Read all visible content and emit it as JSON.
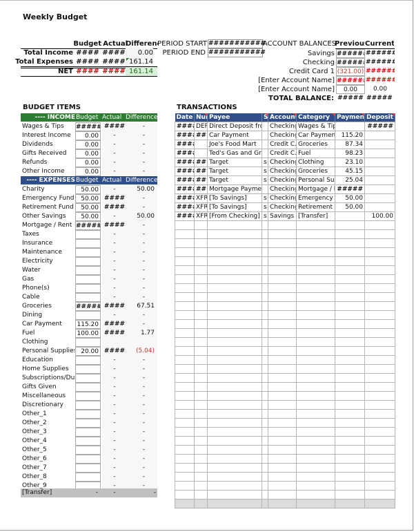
{
  "title": "Weekly Budget",
  "summary": {
    "headers": [
      "Budget",
      "Actual",
      "Difference"
    ],
    "rows": [
      {
        "label": "Total Income",
        "budget": "####",
        "actual": "####",
        "difference": "0.00"
      },
      {
        "label": "Total Expenses",
        "budget": "####",
        "actual": "####",
        "difference": "161.14"
      },
      {
        "label": "NET",
        "budget": "####",
        "actual": "####",
        "difference": "161.14"
      }
    ]
  },
  "period": {
    "start_label": "PERIOD START",
    "start_value": "###########",
    "end_label": "PERIOD END",
    "end_value": "###########"
  },
  "account_balances": {
    "title": "ACCOUNT BALANCES",
    "headers": [
      "Previous",
      "Current"
    ],
    "rows": [
      {
        "name": "Savings",
        "previous": "######",
        "current": "######"
      },
      {
        "name": "Checking",
        "previous": "######",
        "current": "######"
      },
      {
        "name": "Credit Card 1",
        "previous": "(321.00)",
        "current": "######"
      },
      {
        "name": "[Enter Account Name]",
        "previous": "######",
        "current": "######"
      },
      {
        "name": "[Enter Account Name]",
        "previous": "0.00",
        "current": "0.00"
      }
    ],
    "total_label": "TOTAL BALANCE:",
    "total_previous": "#####",
    "total_current": "#####"
  },
  "budget_items": {
    "title": "BUDGET ITEMS",
    "income_header": {
      "label": "---- INCOME",
      "budget": "Budget",
      "actual": "Actual",
      "difference": "Difference"
    },
    "income": [
      {
        "name": "Wages & Tips",
        "budget": "#####",
        "actual": "####",
        "difference": "-"
      },
      {
        "name": "Interest Income",
        "budget": "0.00",
        "actual": "-",
        "difference": "-"
      },
      {
        "name": "Dividends",
        "budget": "0.00",
        "actual": "-",
        "difference": "-"
      },
      {
        "name": "Gifts Received",
        "budget": "0.00",
        "actual": "-",
        "difference": "-"
      },
      {
        "name": "Refunds",
        "budget": "0.00",
        "actual": "-",
        "difference": "-"
      },
      {
        "name": "Other Income",
        "budget": "0.00",
        "actual": "-",
        "difference": "-"
      }
    ],
    "expense_header": {
      "label": "---- EXPENSES",
      "budget": "Budget",
      "actual": "Actual",
      "difference": "Difference"
    },
    "expenses": [
      {
        "name": "Charity",
        "budget": "50.00",
        "actual": "-",
        "difference": "50.00"
      },
      {
        "name": "Emergency Fund",
        "budget": "50.00",
        "actual": "####",
        "difference": "-"
      },
      {
        "name": "Retirement Fund",
        "budget": "50.00",
        "actual": "####",
        "difference": "-"
      },
      {
        "name": "Other Savings",
        "budget": "50.00",
        "actual": "-",
        "difference": "50.00"
      },
      {
        "name": "Mortgage / Rent",
        "budget": "#####",
        "actual": "####",
        "difference": "-"
      },
      {
        "name": "Taxes",
        "budget": "",
        "actual": "-",
        "difference": "-"
      },
      {
        "name": "Insurance",
        "budget": "",
        "actual": "-",
        "difference": "-"
      },
      {
        "name": "Maintenance",
        "budget": "",
        "actual": "-",
        "difference": "-"
      },
      {
        "name": "Electricity",
        "budget": "",
        "actual": "-",
        "difference": "-"
      },
      {
        "name": "Water",
        "budget": "",
        "actual": "-",
        "difference": "-"
      },
      {
        "name": "Gas",
        "budget": "",
        "actual": "-",
        "difference": "-"
      },
      {
        "name": "Phone(s)",
        "budget": "",
        "actual": "-",
        "difference": "-"
      },
      {
        "name": "Cable",
        "budget": "",
        "actual": "-",
        "difference": "-"
      },
      {
        "name": "Groceries",
        "budget": "#####",
        "actual": "####",
        "difference": "67.51"
      },
      {
        "name": "Dining",
        "budget": "",
        "actual": "-",
        "difference": "-"
      },
      {
        "name": "Car Payment",
        "budget": "115.20",
        "actual": "####",
        "difference": "-"
      },
      {
        "name": "Fuel",
        "budget": "100.00",
        "actual": "####",
        "difference": "1.77"
      },
      {
        "name": "Clothing",
        "budget": "",
        "actual": "",
        "difference": ""
      },
      {
        "name": "Personal Supplies",
        "budget": "20.00",
        "actual": "####",
        "difference": "(5.04)"
      },
      {
        "name": "Education",
        "budget": "",
        "actual": "-",
        "difference": "-"
      },
      {
        "name": "Home Supplies",
        "budget": "",
        "actual": "-",
        "difference": "-"
      },
      {
        "name": "Subscriptions/Dues",
        "budget": "",
        "actual": "-",
        "difference": "-"
      },
      {
        "name": "Gifts Given",
        "budget": "",
        "actual": "-",
        "difference": "-"
      },
      {
        "name": "Miscellaneous",
        "budget": "",
        "actual": "-",
        "difference": "-"
      },
      {
        "name": "Discretionary",
        "budget": "",
        "actual": "-",
        "difference": "-"
      },
      {
        "name": "Other_1",
        "budget": "",
        "actual": "-",
        "difference": "-"
      },
      {
        "name": "Other_2",
        "budget": "",
        "actual": "-",
        "difference": "-"
      },
      {
        "name": "Other_3",
        "budget": "",
        "actual": "-",
        "difference": "-"
      },
      {
        "name": "Other_4",
        "budget": "",
        "actual": "-",
        "difference": "-"
      },
      {
        "name": "Other_5",
        "budget": "",
        "actual": "-",
        "difference": "-"
      },
      {
        "name": "Other_6",
        "budget": "",
        "actual": "-",
        "difference": "-"
      },
      {
        "name": "Other_7",
        "budget": "",
        "actual": "-",
        "difference": "-"
      },
      {
        "name": "Other_8",
        "budget": "",
        "actual": "-",
        "difference": "-"
      },
      {
        "name": "Other_9",
        "budget": "",
        "actual": "-",
        "difference": "-"
      }
    ],
    "transfer_row": {
      "name": "[Transfer]",
      "budget": "-",
      "actual": "-",
      "difference": "-"
    }
  },
  "transactions": {
    "title": "TRANSACTIONS",
    "headers": [
      "Date",
      "Num",
      "Payee",
      "S",
      "Account",
      "Category",
      "Payment",
      "Deposit"
    ],
    "rows": [
      [
        "####",
        "DEP",
        "Direct Deposit from",
        "",
        "Checking",
        "Wages & Tips",
        "",
        "#####"
      ],
      [
        "####",
        "##",
        "Car Payment",
        "",
        "Checking",
        "Car Payment",
        "115.20",
        ""
      ],
      [
        "####",
        "",
        "Joe's Food Mart",
        "",
        "Credit C.",
        "Groceries",
        "87.34",
        ""
      ],
      [
        "####",
        "",
        "Ted's Gas and Grub",
        "",
        "Credit C.",
        "Fuel",
        "98.23",
        ""
      ],
      [
        "####",
        "##",
        "Target",
        "s",
        "Checking",
        "Clothing",
        "23.10",
        ""
      ],
      [
        "####",
        "##",
        "Target",
        "s",
        "Checking",
        "Groceries",
        "45.15",
        ""
      ],
      [
        "####",
        "##",
        "Target",
        "s",
        "Checking",
        "Personal Supplies",
        "25.04",
        ""
      ],
      [
        "####",
        "##",
        "Mortgage Payment",
        "",
        "Checking",
        "Mortgage / Rent",
        "#####",
        ""
      ],
      [
        "####",
        "XFR",
        "[To Savings]",
        "s",
        "Checking",
        "Emergency",
        "50.00",
        ""
      ],
      [
        "####",
        "XFR",
        "[To Savings]",
        "s",
        "Checking",
        "Retirement",
        "50.00",
        ""
      ],
      [
        "####",
        "XFR",
        "[From Checking]",
        "s",
        "Savings",
        "[Transfer]",
        "",
        "100.00"
      ]
    ],
    "empty_rows": 32
  },
  "colors": {
    "income_header": "#2e7d32",
    "expense_header": "#2f4e8a",
    "transactions_header": "#2f4e8a",
    "negative": "#c0392b",
    "net_bg": "#d9f2d9",
    "transfer_bg": "#c0c0c0"
  }
}
